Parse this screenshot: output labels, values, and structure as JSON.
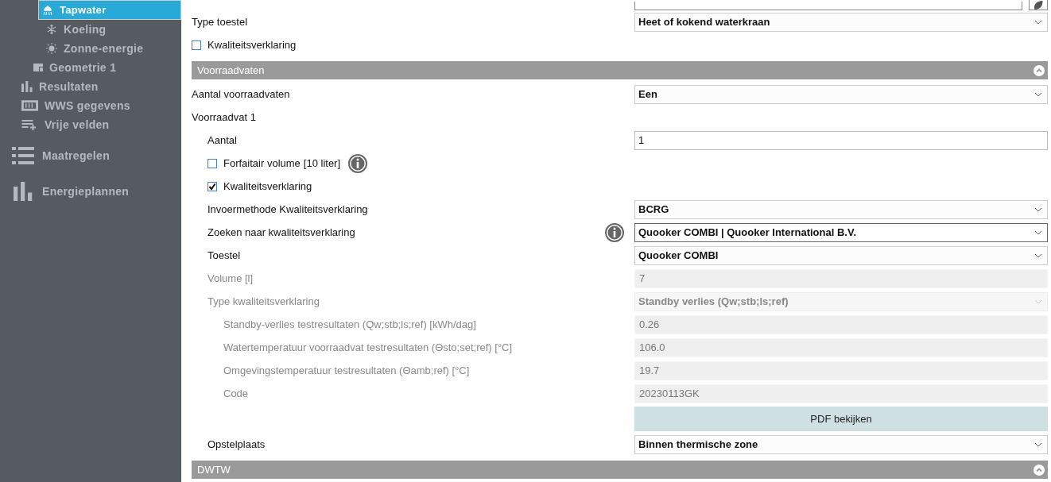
{
  "sidebar": {
    "items": [
      {
        "kind": "sub",
        "label": "Tapwater",
        "selected": true
      },
      {
        "kind": "sub",
        "label": "Koeling",
        "selected": false
      },
      {
        "kind": "sub",
        "label": "Zonne-energie",
        "selected": false
      },
      {
        "kind": "zone",
        "label": "Geometrie 1",
        "selected": false
      },
      {
        "kind": "item",
        "label": "Resultaten",
        "selected": false
      },
      {
        "kind": "item",
        "label": "WWS gegevens",
        "selected": false
      },
      {
        "kind": "item",
        "label": "Vrije velden",
        "selected": false
      },
      {
        "kind": "main",
        "label": "Maatregelen",
        "selected": false
      },
      {
        "kind": "main",
        "label": "Energieplannen",
        "selected": false
      }
    ]
  },
  "form": {
    "top": [
      {
        "kind": "partial"
      },
      {
        "kind": "select",
        "label": "Type toestel",
        "value": "Heet of kokend waterkraan",
        "disabled": false
      },
      {
        "kind": "checkbox",
        "label": "Kwaliteitsverklaring",
        "checked": false
      }
    ],
    "sections": [
      {
        "title": "Voorraadvaten",
        "expanded": true,
        "rows": [
          {
            "kind": "select",
            "label": "Aantal voorraadvaten",
            "value": "Een",
            "disabled": false
          },
          {
            "kind": "group",
            "label": "Voorraadvat 1",
            "children": [
              {
                "kind": "input",
                "label": "Aantal",
                "value": "1",
                "disabled": false
              },
              {
                "kind": "checkbox",
                "label": "Forfaitair volume",
                "unit": "[10 liter]",
                "checked": false,
                "info": true
              },
              {
                "kind": "checkbox",
                "label": "Kwaliteitsverklaring",
                "checked": true
              },
              {
                "kind": "select",
                "label": "Invoermethode Kwaliteitsverklaring",
                "value": "BCRG",
                "disabled": false
              },
              {
                "kind": "select",
                "label": "Zoeken naar kwaliteitsverklaring",
                "value": "Quooker COMBI | Quooker International B.V.",
                "disabled": false,
                "info": true,
                "focused": true
              },
              {
                "kind": "select",
                "label": "Toestel",
                "value": "Quooker COMBI",
                "disabled": false
              },
              {
                "kind": "input",
                "label": "Volume [l]",
                "value": "7",
                "disabled": true
              },
              {
                "kind": "select",
                "label": "Type kwaliteitsverklaring",
                "value": "Standby verlies (Qw;stb;ls;ref)",
                "disabled": true,
                "children": [
                  {
                    "kind": "input",
                    "label": "Standby-verlies testresultaten (Qw;stb;ls;ref) [kWh/dag]",
                    "value": "0.26",
                    "disabled": true
                  },
                  {
                    "kind": "input",
                    "label": "Watertemperatuur voorraadvat testresultaten (Θsto;set;ref) [°C]",
                    "value": "106.0",
                    "disabled": true
                  },
                  {
                    "kind": "input",
                    "label": "Omgevingstemperatuur testresultaten (Θamb;ref) [°C]",
                    "value": "19.7",
                    "disabled": true
                  },
                  {
                    "kind": "input",
                    "label": "Code",
                    "value": "20230113GK",
                    "disabled": true
                  }
                ]
              },
              {
                "kind": "button",
                "label": "PDF bekijken"
              },
              {
                "kind": "select",
                "label": "Opstelplaats",
                "value": "Binnen thermische zone",
                "disabled": false
              }
            ]
          }
        ]
      },
      {
        "title": "DWTW",
        "expanded": true
      }
    ]
  }
}
